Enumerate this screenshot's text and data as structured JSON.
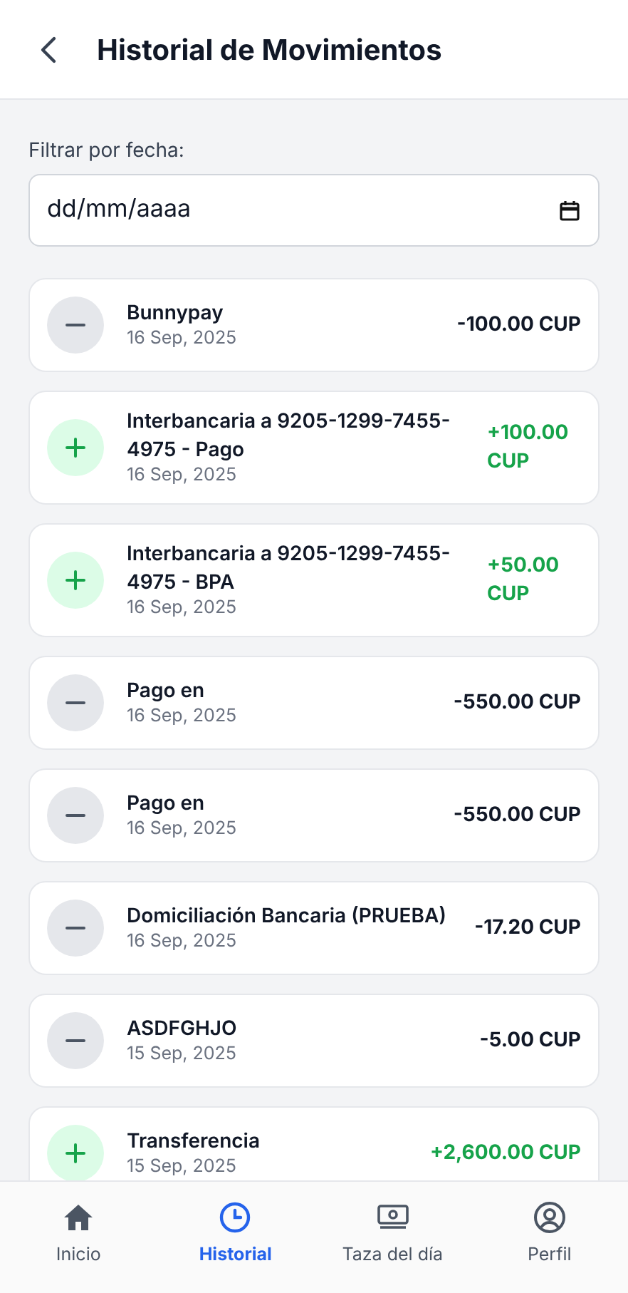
{
  "header": {
    "title": "Historial de Movimientos"
  },
  "filter": {
    "label": "Filtrar por fecha:",
    "placeholder": "dd/mm/aaaa"
  },
  "transactions": [
    {
      "kind": "debit",
      "title": "Bunnypay",
      "date": "16 Sep, 2025",
      "amount": "-100.00 CUP"
    },
    {
      "kind": "credit",
      "title": "Interbancaria a 9205-1299-7455-4975 - Pago",
      "date": "16 Sep, 2025",
      "amount": "+100.00 CUP"
    },
    {
      "kind": "credit",
      "title": "Interbancaria a 9205-1299-7455-4975 - BPA",
      "date": "16 Sep, 2025",
      "amount": "+50.00 CUP"
    },
    {
      "kind": "debit",
      "title": "Pago en",
      "date": "16 Sep, 2025",
      "amount": "-550.00 CUP"
    },
    {
      "kind": "debit",
      "title": "Pago en",
      "date": "16 Sep, 2025",
      "amount": "-550.00 CUP"
    },
    {
      "kind": "debit",
      "title": "Domiciliación Bancaria (PRUEBA)",
      "date": "16 Sep, 2025",
      "amount": "-17.20 CUP"
    },
    {
      "kind": "debit",
      "title": "ASDFGHJO",
      "date": "15 Sep, 2025",
      "amount": "-5.00 CUP"
    },
    {
      "kind": "credit",
      "title": "Transferencia",
      "date": "15 Sep, 2025",
      "amount": "+2,600.00 CUP"
    }
  ],
  "nav": [
    {
      "kind": "home",
      "label": "Inicio",
      "selected": false
    },
    {
      "kind": "history",
      "label": "Historial",
      "selected": true
    },
    {
      "kind": "money",
      "label": "Taza del día",
      "selected": false
    },
    {
      "kind": "profile",
      "label": "Perfil",
      "selected": false
    }
  ]
}
